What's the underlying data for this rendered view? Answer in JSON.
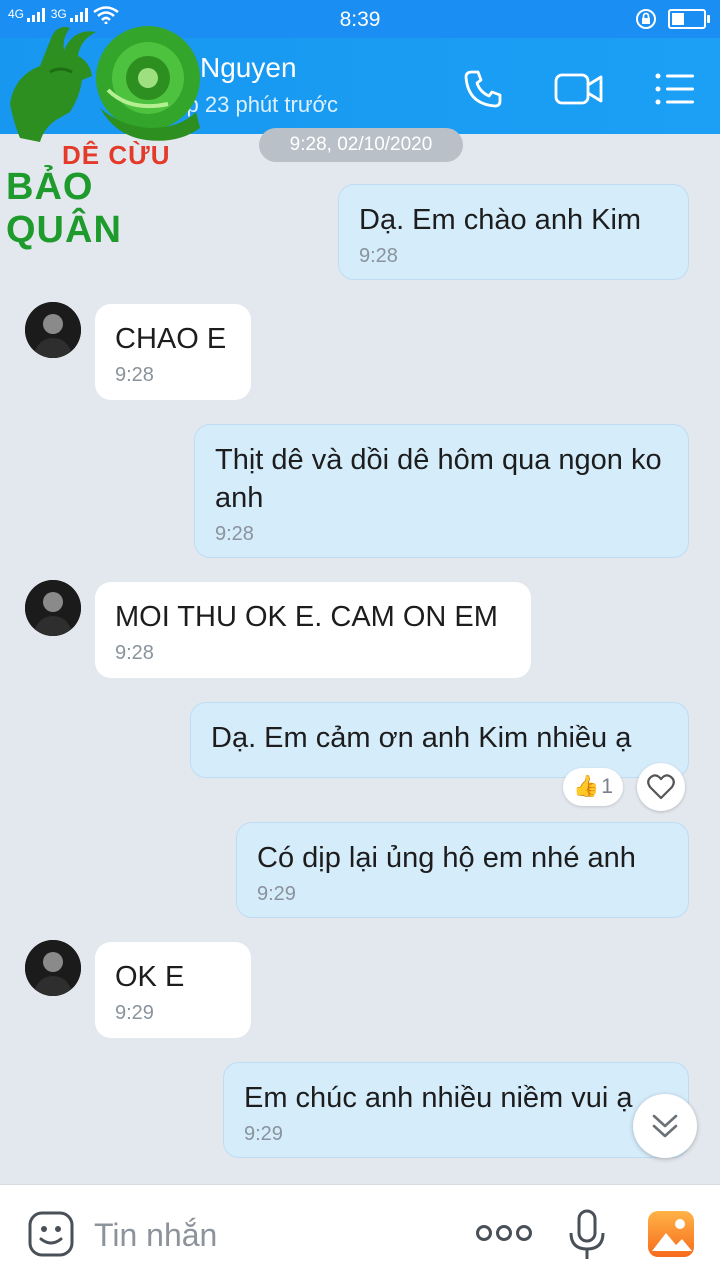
{
  "status_bar": {
    "time": "8:39",
    "network_left": "4G",
    "network_right": "3G"
  },
  "header": {
    "contact_name": "Nguyen",
    "last_seen": "Truy cập 23 phút trước",
    "icons": [
      "back-icon",
      "phone-icon",
      "video-call-icon",
      "menu-icon"
    ]
  },
  "watermark": {
    "line1": "DÊ CỪU",
    "line2": "BẢO QUÂN"
  },
  "chat": {
    "date_separator": "9:28, 02/10/2020",
    "messages": [
      {
        "direction": "out",
        "text": "Dạ.  Em chào anh Kim",
        "time": "9:28"
      },
      {
        "direction": "in",
        "text": "CHAO E",
        "time": "9:28"
      },
      {
        "direction": "out",
        "text": "Thịt dê và dồi dê hôm qua ngon ko anh",
        "time": "9:28"
      },
      {
        "direction": "in",
        "text": "MOI THU OK E. CAM ON EM",
        "time": "9:28"
      },
      {
        "direction": "out",
        "text": "Dạ.  Em cảm ơn anh Kim nhiều ạ",
        "time": ""
      },
      {
        "direction": "out",
        "text": "Có dịp lại ủng hộ em nhé anh",
        "time": "9:29"
      },
      {
        "direction": "in",
        "text": "OK E",
        "time": "9:29"
      },
      {
        "direction": "out",
        "text": "Em chúc anh nhiều niềm vui ạ",
        "time": "9:29"
      }
    ],
    "reaction": {
      "emoji": "👍",
      "count": "1"
    }
  },
  "composer": {
    "placeholder": "Tin nhắn",
    "icons": [
      "emoji-icon",
      "more-icon",
      "microphone-icon",
      "image-icon"
    ]
  },
  "colors": {
    "header_blue": "#1a8ef2",
    "outgoing_bubble": "#d5ecfb",
    "incoming_bubble": "#ffffff",
    "background": "#e3e8ee"
  }
}
